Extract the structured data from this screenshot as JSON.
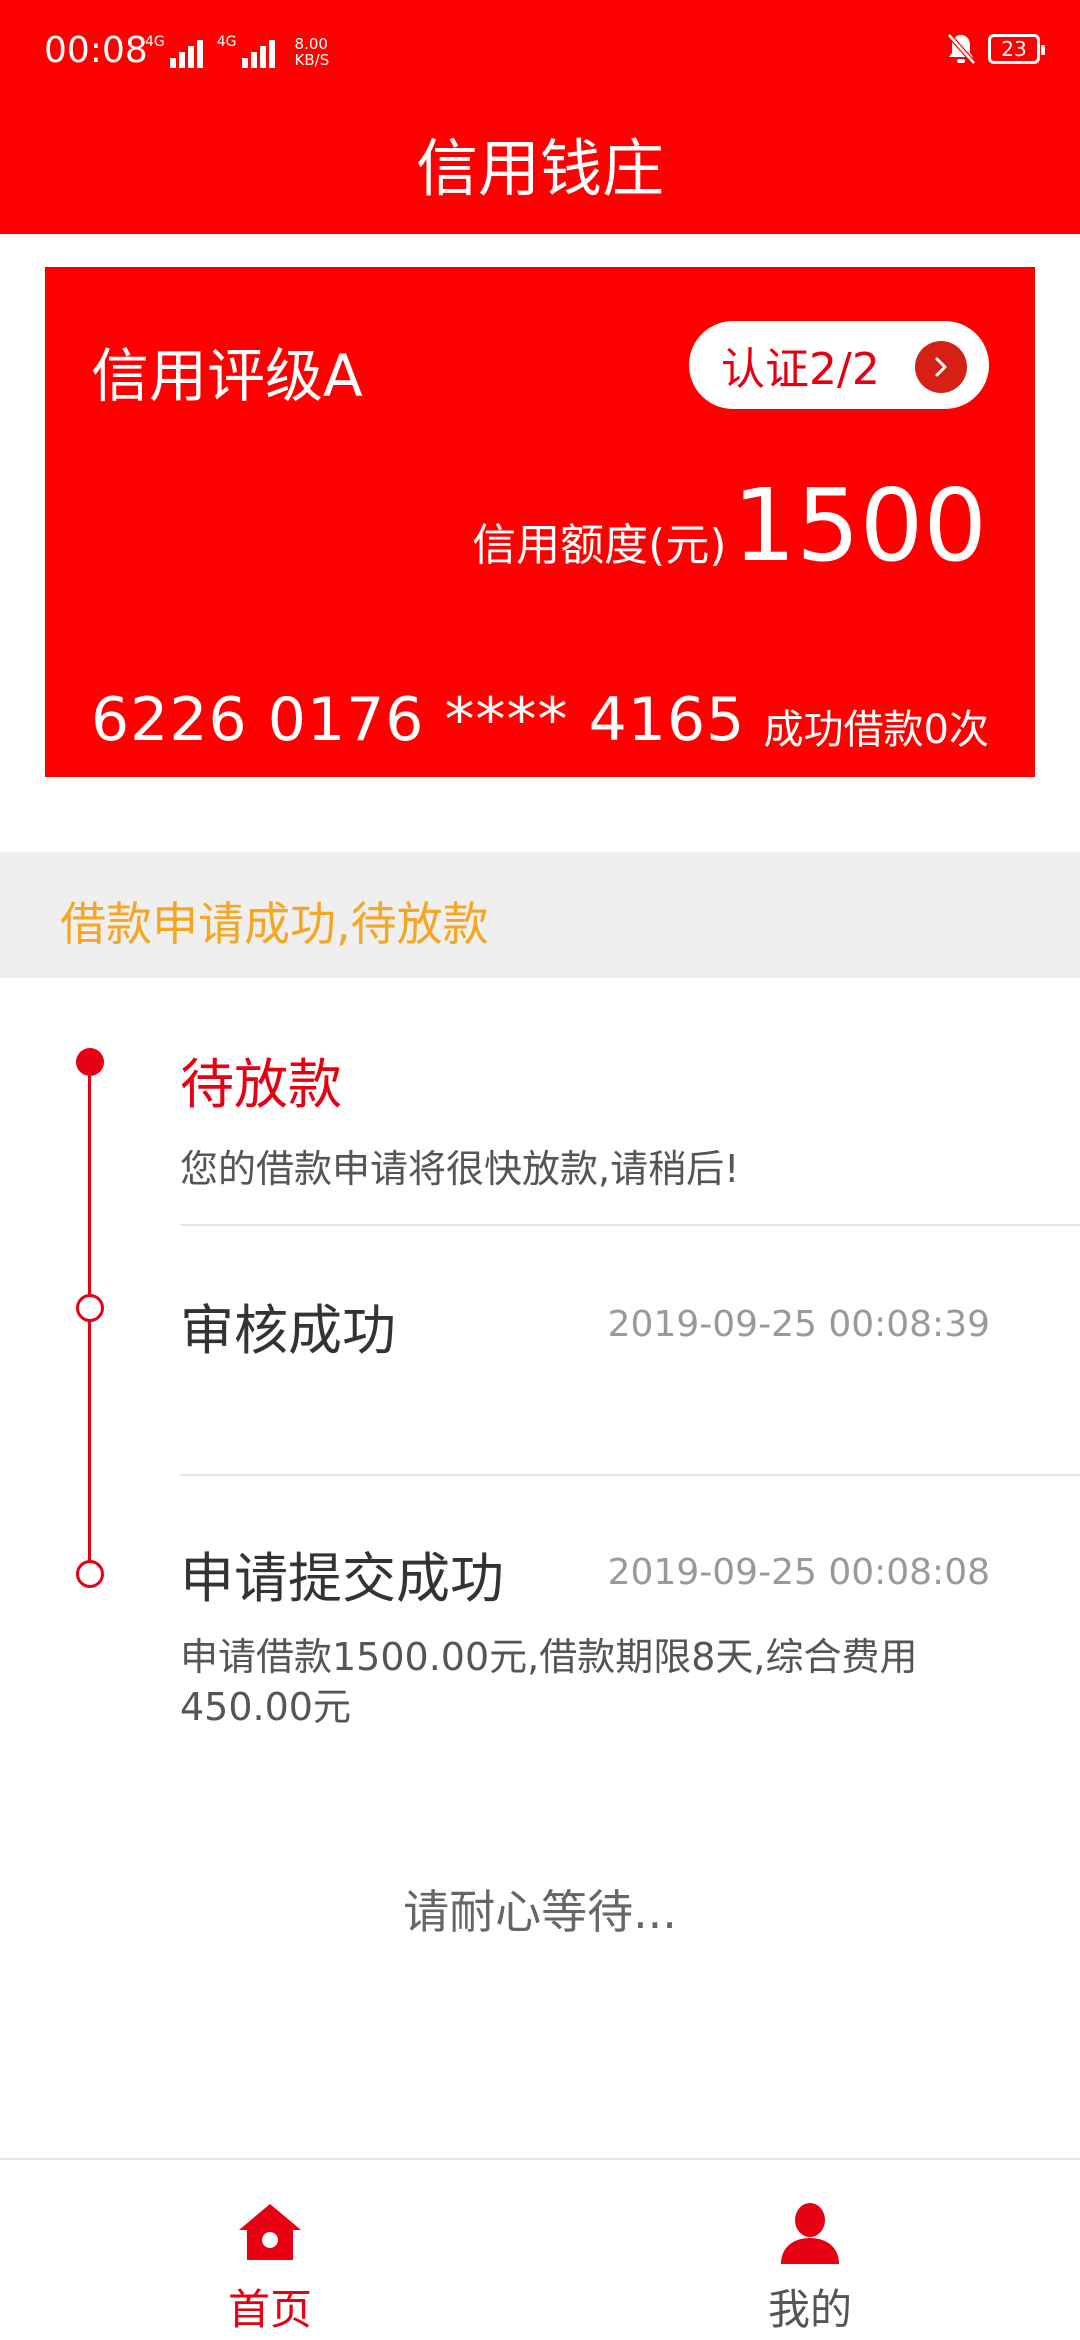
{
  "status_bar": {
    "time": "00:08",
    "net_tag_1": "4G",
    "net_tag_2": "4G",
    "speed_value": "8.00",
    "speed_unit": "KB/S",
    "battery": "23"
  },
  "header": {
    "title": "信用钱庄"
  },
  "card": {
    "rating": "信用评级A",
    "verify_label": "认证2/2",
    "limit_label": "信用额度(元)",
    "limit_value": "1500",
    "card_number": "6226 0176 **** 4165",
    "loan_count": "成功借款0次"
  },
  "banner": {
    "text": "借款申请成功,待放款"
  },
  "timeline": {
    "items": [
      {
        "title": "待放款",
        "desc": "您的借款申请将很快放款,请稍后!"
      },
      {
        "title": "审核成功",
        "time": "2019-09-25 00:08:39"
      },
      {
        "title": "申请提交成功",
        "time": "2019-09-25 00:08:08",
        "desc": "申请借款1500.00元,借款期限8天,综合费用450.00元"
      }
    ]
  },
  "wait_text": "请耐心等待...",
  "bottom_nav": {
    "home_label": "首页",
    "mine_label": "我的"
  },
  "colors": {
    "brand_red": "#ff0000",
    "accent_red": "#e60012",
    "banner_text": "#f5a623"
  }
}
